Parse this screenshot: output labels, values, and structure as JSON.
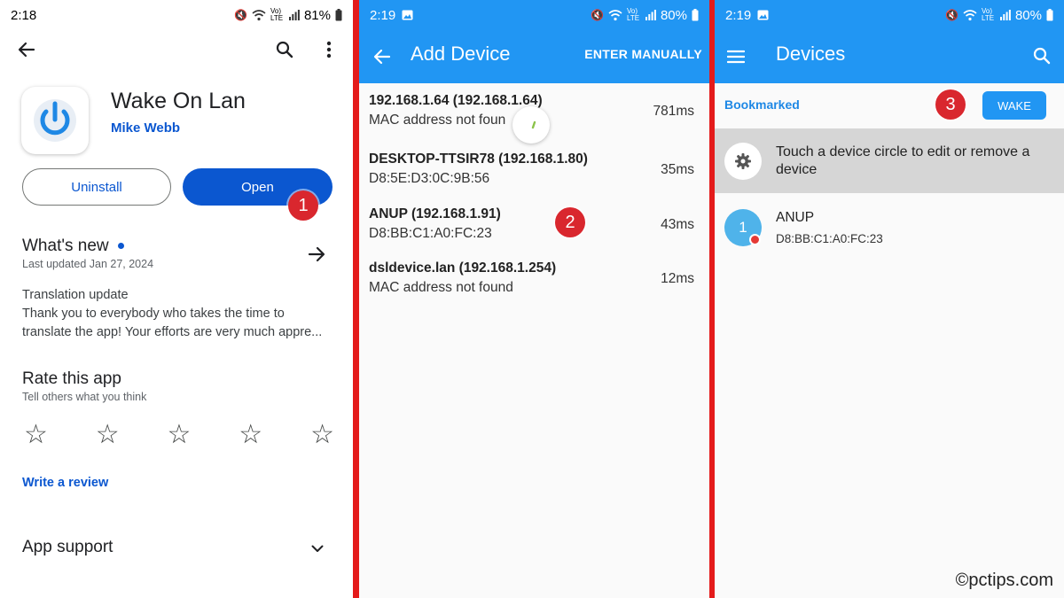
{
  "panel1": {
    "status": {
      "time": "2:18",
      "battery": "81%",
      "signal_text": "Vo) LTE"
    },
    "app_name": "Wake On Lan",
    "developer": "Mike Webb",
    "uninstall_label": "Uninstall",
    "open_label": "Open",
    "callout": "1",
    "whats_new": {
      "title": "What's new",
      "updated": "Last updated Jan 27, 2024",
      "body_line1": "Translation update",
      "body_line2": "Thank you to everybody who takes the time to translate the app! Your efforts are very much appre..."
    },
    "rate": {
      "title": "Rate this app",
      "subtitle": "Tell others what you think",
      "stars": 5
    },
    "write_review": "Write a review",
    "app_support": "App support",
    "icons": [
      "back-arrow-icon",
      "search-icon",
      "more-vert-icon",
      "arrow-right-icon",
      "star-outline-icon",
      "chevron-down-icon"
    ]
  },
  "panel2": {
    "status": {
      "time": "2:19",
      "battery": "80%",
      "signal_text": "Vo) LTE"
    },
    "title": "Add Device",
    "action": "ENTER MANUALLY",
    "callout": "2",
    "devices": [
      {
        "name": "192.168.1.64 (192.168.1.64)",
        "mac": "MAC address not foun",
        "time": "781ms"
      },
      {
        "name": "DESKTOP-TTSIR78 (192.168.1.80)",
        "mac": "D8:5E:D3:0C:9B:56",
        "time": "35ms"
      },
      {
        "name": "ANUP (192.168.1.91)",
        "mac": "D8:BB:C1:A0:FC:23",
        "time": "43ms"
      },
      {
        "name": "dsldevice.lan (192.168.1.254)",
        "mac": "MAC address not found",
        "time": "12ms"
      }
    ]
  },
  "panel3": {
    "status": {
      "time": "2:19",
      "battery": "80%",
      "signal_text": "Vo) LTE"
    },
    "title": "Devices",
    "bookmarked": "Bookmarked",
    "wake_label": "WAKE",
    "callout": "3",
    "hint": "Touch a device circle to edit or remove a device",
    "device": {
      "number": "1",
      "name": "ANUP",
      "mac": "D8:BB:C1:A0:FC:23"
    },
    "watermark": "©pctips.com"
  },
  "colors": {
    "blue_bar": "#2196f3",
    "play_blue": "#0b57d0",
    "callout_red": "#d9272e",
    "divider_red": "#e41b1b"
  }
}
